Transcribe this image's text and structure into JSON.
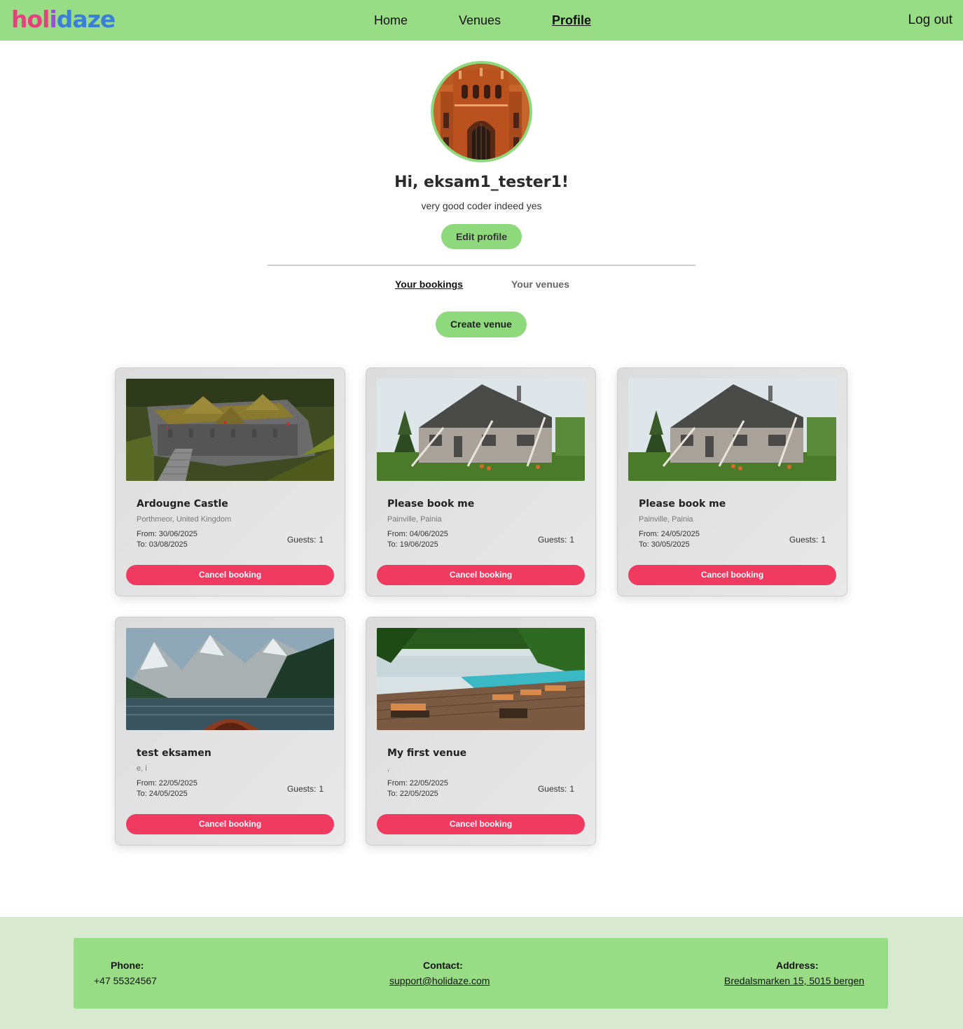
{
  "header": {
    "logo": [
      "hol",
      "i",
      "daze"
    ],
    "nav": [
      {
        "label": "Home"
      },
      {
        "label": "Venues"
      },
      {
        "label": "Profile"
      }
    ],
    "logout": "Log out"
  },
  "profile": {
    "greeting": "Hi, eksam1_tester1!",
    "bio": "very good coder indeed yes",
    "edit_label": "Edit profile"
  },
  "tabs": [
    "Your bookings",
    "Your venues"
  ],
  "create_label": "Create venue",
  "bookings": [
    {
      "title": "Ardougne Castle",
      "location": "Porthmeor, United Kingdom",
      "from": "From: 30/06/2025",
      "to": "To: 03/08/2025",
      "guests_label": "Guests:",
      "guests": "1",
      "cancel": "Cancel booking",
      "image": "castle"
    },
    {
      "title": "Please book me",
      "location": "Painville, Painia",
      "from": "From: 04/06/2025",
      "to": "To: 19/06/2025",
      "guests_label": "Guests:",
      "guests": "1",
      "cancel": "Cancel booking",
      "image": "old-house"
    },
    {
      "title": "Please book me",
      "location": "Painville, Painia",
      "from": "From: 24/05/2025",
      "to": "To: 30/05/2025",
      "guests_label": "Guests:",
      "guests": "1",
      "cancel": "Cancel booking",
      "image": "old-house"
    },
    {
      "title": "test eksamen",
      "location": "e, i",
      "from": "From: 22/05/2025",
      "to": "To: 24/05/2025",
      "guests_label": "Guests:",
      "guests": "1",
      "cancel": "Cancel booking",
      "image": "mountain-lake"
    },
    {
      "title": "My first venue",
      "location": ",",
      "from": "From: 22/05/2025",
      "to": "To: 22/05/2025",
      "guests_label": "Guests:",
      "guests": "1",
      "cancel": "Cancel booking",
      "image": "pool-deck"
    }
  ],
  "footer": {
    "phone_label": "Phone:",
    "phone": "+47 55324567",
    "contact_label": "Contact:",
    "contact": "support@holidaze.com",
    "address_label": "Address:",
    "address": "Bredalsmarken 15, 5015 bergen"
  },
  "colors": {
    "header_bg": "#98dd86",
    "accent_green": "#8fd97d",
    "cancel_red": "#f03a5f",
    "footer_bg": "#d8e9cf"
  }
}
